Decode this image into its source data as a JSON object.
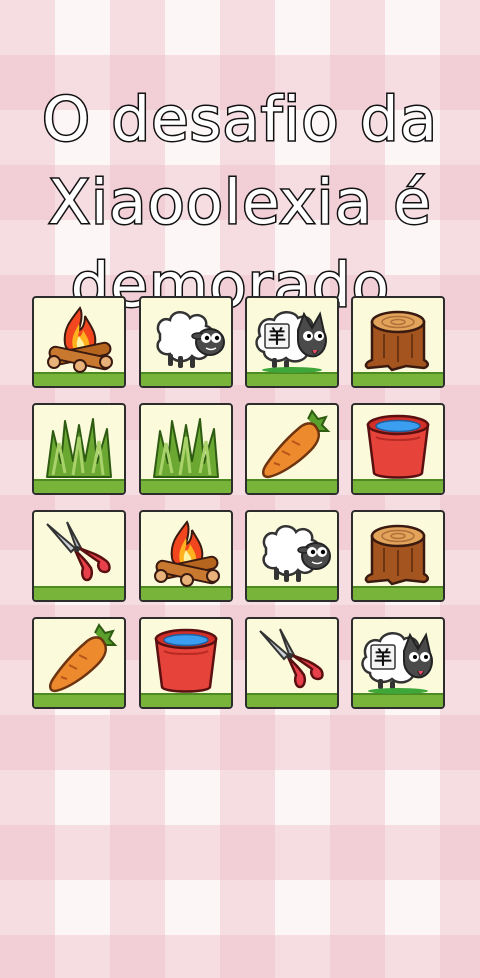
{
  "header": {
    "title_line1": "O desafio da",
    "title_line2": "Xiaoolexia é",
    "title_line3": "demorado."
  },
  "board": {
    "rows": [
      [
        "bonfire-icon",
        "sheep-icon",
        "wolf-sheep-icon",
        "tree-stump-icon"
      ],
      [
        "grass-icon",
        "grass-icon",
        "carrot-icon",
        "water-bucket-icon"
      ],
      [
        "shears-icon",
        "bonfire-icon",
        "sheep-icon",
        "tree-stump-icon"
      ],
      [
        "carrot-icon",
        "water-bucket-icon",
        "shears-icon",
        "wolf-sheep-icon"
      ]
    ],
    "wolf_label": "羊"
  },
  "colors": {
    "tile_face": "#fbfbdc",
    "tile_base": "#79b43a",
    "tile_border": "#2d2d2d",
    "background_check": "#ecbec8"
  }
}
